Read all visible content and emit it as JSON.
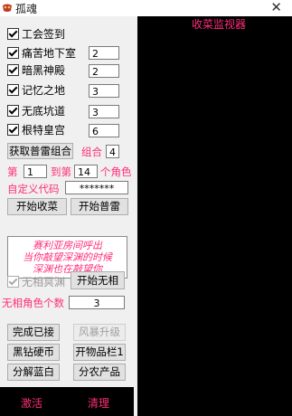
{
  "window": {
    "title": "孤魂",
    "close_glyph": "✕"
  },
  "checks": [
    {
      "label": "工会签到",
      "checked": true
    },
    {
      "label": "痛苦地下室",
      "checked": true,
      "value": "2"
    },
    {
      "label": "暗黑神殿",
      "checked": true,
      "value": "2"
    },
    {
      "label": "记忆之地",
      "checked": true,
      "value": "3"
    },
    {
      "label": "无底坑道",
      "checked": true,
      "value": "3"
    },
    {
      "label": "根特皇宫",
      "checked": true,
      "value": "6"
    }
  ],
  "group": {
    "button": "获取普雷组合",
    "label": "组合",
    "value": "4"
  },
  "range": {
    "prefix": "第",
    "from": "1",
    "middle": "到第",
    "to": "14",
    "suffix": "个角色"
  },
  "custom_code": {
    "label": "自定义代码",
    "value": "*******"
  },
  "buttons": {
    "start_collect": "开始收菜",
    "start_prey": "开始普雷",
    "no_phase": "无相冥渊",
    "start_no_phase": "开始无相",
    "complete": "完成已接",
    "storm": "风暴升级",
    "black_coin": "黑钻硬币",
    "open_item": "开物品栏1",
    "decompose": "分解蓝白",
    "farm": "分农产品"
  },
  "notice": [
    "赛利亚房间呼出",
    "当你敲望深渊的时候",
    "深渊也在敲望你"
  ],
  "no_phase_count": {
    "label": "无相角色个数",
    "value": "3"
  },
  "bottom": {
    "activate": "激活",
    "clear": "清理"
  },
  "monitor": {
    "title": "收菜监视器"
  },
  "colors": {
    "accent": "#ff2d78",
    "monitor_bg": "#000000",
    "panel_bg": "#f0f0f0"
  },
  "icons": {
    "app": "app-logo-icon",
    "close": "close-icon"
  }
}
